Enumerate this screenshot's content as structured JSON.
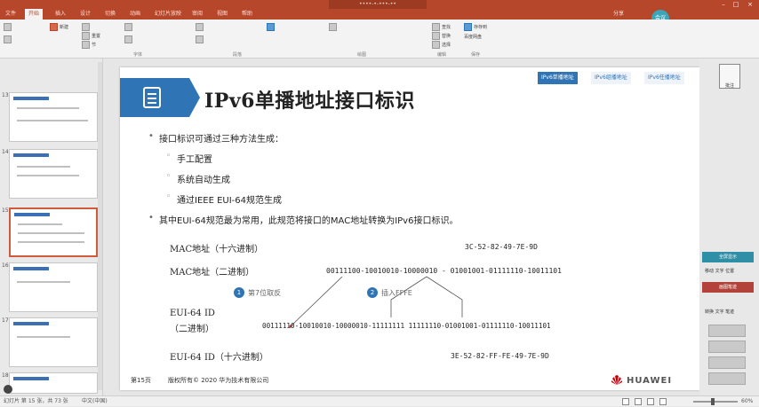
{
  "colors": {
    "brand": "#b7472a",
    "accent": "#2f74b5",
    "rp_teal": "#2f8fa6",
    "rp_red": "#b3423a"
  },
  "window": {
    "title": "••••-•-•••-••",
    "minimize": "–",
    "maximize": "□",
    "close": "×"
  },
  "ribbon": {
    "tabs": [
      "文件",
      "开始",
      "插入",
      "设计",
      "切换",
      "动画",
      "幻灯片放映",
      "审阅",
      "视图",
      "帮助",
      "分享"
    ],
    "active_tab": "开始",
    "user_initials": "会议"
  },
  "ribbon_groups": [
    "字体",
    "段落",
    "绘图",
    "编辑",
    "保存"
  ],
  "ribbon_buttons": {
    "new_slide": "新建",
    "reset": "重置",
    "section": "节",
    "find": "查找",
    "replace": "替换",
    "select": "选择",
    "save_to": "存存到",
    "cloud": "百度网盘",
    "save_group": "保存"
  },
  "thumbnails": [
    {
      "num": "13",
      "selected": false
    },
    {
      "num": "14",
      "selected": false
    },
    {
      "num": "15",
      "selected": true
    },
    {
      "num": "16",
      "selected": false
    },
    {
      "num": "17",
      "selected": false
    },
    {
      "num": "18",
      "selected": false
    }
  ],
  "slide": {
    "nav": [
      "IPv6单播地址",
      "IPv6组播地址",
      "IPv6任播地址"
    ],
    "title": "IPv6单播地址接口标识",
    "bullets": [
      {
        "level": 1,
        "text": "接口标识可通过三种方法生成："
      },
      {
        "level": 2,
        "text": "手工配置"
      },
      {
        "level": 2,
        "text": "系统自动生成"
      },
      {
        "level": 2,
        "text": "通过IEEE EUI-64规范生成"
      },
      {
        "level": 1,
        "text": "其中EUI-64规范最为常用，此规范将接口的MAC地址转换为IPv6接口标识。"
      }
    ],
    "diagram": {
      "mac_hex_label": "MAC地址（十六进制）",
      "mac_hex_value": "3C-52-82-49-7E-9D",
      "mac_bin_label": "MAC地址（二进制）",
      "mac_bin_value": "00111100-10010010-10000010 - 01001001-01111110-10011101",
      "step1_num": "1",
      "step1_label": "第7位取反",
      "step2_num": "2",
      "step2_label": "插入FFFE",
      "eui_bin_label_1": "EUI-64 ID",
      "eui_bin_label_2": "（二进制）",
      "eui_bin_value": "00111110-10010010-10000010-11111111 11111110-01001001-01111110-10011101",
      "eui_hex_label": "EUI-64 ID（十六进制）",
      "eui_hex_value": "3E-52-82-FF-FE-49-7E-9D"
    },
    "footer": {
      "page": "第15页",
      "copyright": "版权所有© 2020 华为技术有限公司",
      "brand": "HUAWEI"
    }
  },
  "right_pane": {
    "panel_title": "批注",
    "buttons": [
      "全屏显示",
      "移动 文字 位置",
      "画图笔迹",
      "转换 文字 笔迹"
    ]
  },
  "status": {
    "slide_info": "幻灯片 第 15 张，共 73 张",
    "language": "中文(中国)",
    "zoom": "60%"
  }
}
